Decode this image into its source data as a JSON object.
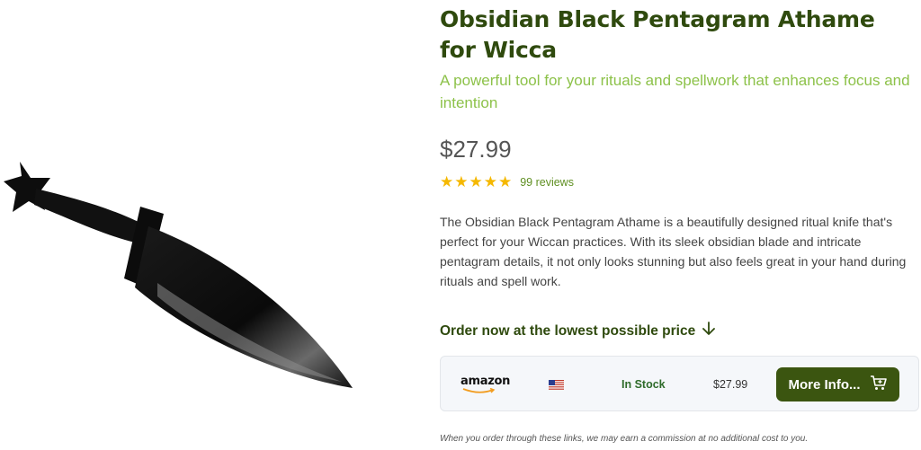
{
  "product": {
    "title": "Obsidian Black Pentagram Athame for Wicca",
    "subtitle": "A powerful tool for your rituals and spellwork that enhances focus and intention",
    "price": "$27.99",
    "rating_stars": "★★★★★",
    "reviews": "99 reviews",
    "description": "The Obsidian Black Pentagram Athame is a beautifully designed ritual knife that's perfect for your Wiccan practices. With its sleek obsidian blade and intricate pentagram details, it not only looks stunning but also feels great in your hand during rituals and spell work."
  },
  "order": {
    "heading": "Order now at the lowest possible price",
    "offer": {
      "retailer": "amazon",
      "flag": "us-flag-icon",
      "stock": "In Stock",
      "price": "$27.99",
      "button_label": "More Info..."
    }
  },
  "disclaimer": "When you order through these links, we may earn a commission at no additional cost to you.",
  "colors": {
    "title": "#2f4a0e",
    "subtitle": "#8dc24a",
    "stars": "#f5b800",
    "button": "#3b5510",
    "stock": "#2e6b2a"
  }
}
